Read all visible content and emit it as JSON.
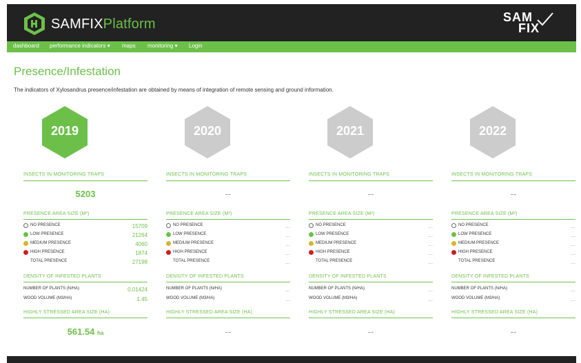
{
  "header": {
    "logo_text_main": "SAMFIX",
    "logo_text_accent": "Platform",
    "logo_icon": "hexagon-logo-icon",
    "right_logo_top": "SAM",
    "right_logo_bottom": "FIX"
  },
  "nav": {
    "items": [
      {
        "label": "dashboard"
      },
      {
        "label": "performance indicators ▾"
      },
      {
        "label": "maps"
      },
      {
        "label": "monitoring ▾"
      },
      {
        "label": "Login"
      }
    ]
  },
  "page": {
    "title": "Presence/Infestation",
    "intro": "The indicators of Xylosandrus presence/infestation are obtained by means of integration of remote sensing and ground information."
  },
  "colors": {
    "accent": "#6cc04a",
    "inactive_hex": "#cccccc",
    "dark_bar": "#222222",
    "no_presence": "#ffffff",
    "low_presence": "#6cc04a",
    "medium_presence": "#d4b62a",
    "high_presence": "#cc1f1f"
  },
  "sections": {
    "insects": "INSECTS IN MONITORING TRAPS",
    "presence": "PRESENCE AREA SIZE (m²)",
    "density": "DENSITY OF INFESTED PLANTS",
    "stressed": "HIGHLY STRESSED AREA SIZE (ha)"
  },
  "labels": {
    "no_presence": "NO PRESENCE",
    "low_presence": "LOW PRESENCE",
    "medium_presence": "MEDIUM PRESENCE",
    "high_presence": "HIGH PRESENCE",
    "total_presence": "TOTAL PRESENCE",
    "plants": "NUMBER OF PLANTS (n/ha)",
    "wood": "WOOD VOLUME (m3/ha)"
  },
  "years": [
    {
      "year": "2019",
      "active": true,
      "insects": "5203",
      "no_presence": "15709",
      "low_presence": "21264",
      "medium_presence": "4060",
      "high_presence": "1874",
      "total_presence": "27198",
      "plants": "0.01424",
      "wood": "1.45",
      "stressed": "561.54",
      "stressed_unit": "ha"
    },
    {
      "year": "2020",
      "active": false,
      "insects": "--",
      "no_presence": "...",
      "low_presence": "...",
      "medium_presence": "...",
      "high_presence": "...",
      "total_presence": "...",
      "plants": "...",
      "wood": "...",
      "stressed": "--",
      "stressed_unit": ""
    },
    {
      "year": "2021",
      "active": false,
      "insects": "--",
      "no_presence": "...",
      "low_presence": "...",
      "medium_presence": "...",
      "high_presence": "...",
      "total_presence": "...",
      "plants": "...",
      "wood": "...",
      "stressed": "--",
      "stressed_unit": ""
    },
    {
      "year": "2022",
      "active": false,
      "insects": "--",
      "no_presence": "...",
      "low_presence": "...",
      "medium_presence": "...",
      "high_presence": "...",
      "total_presence": "...",
      "plants": "...",
      "wood": "...",
      "stressed": "--",
      "stressed_unit": ""
    }
  ]
}
